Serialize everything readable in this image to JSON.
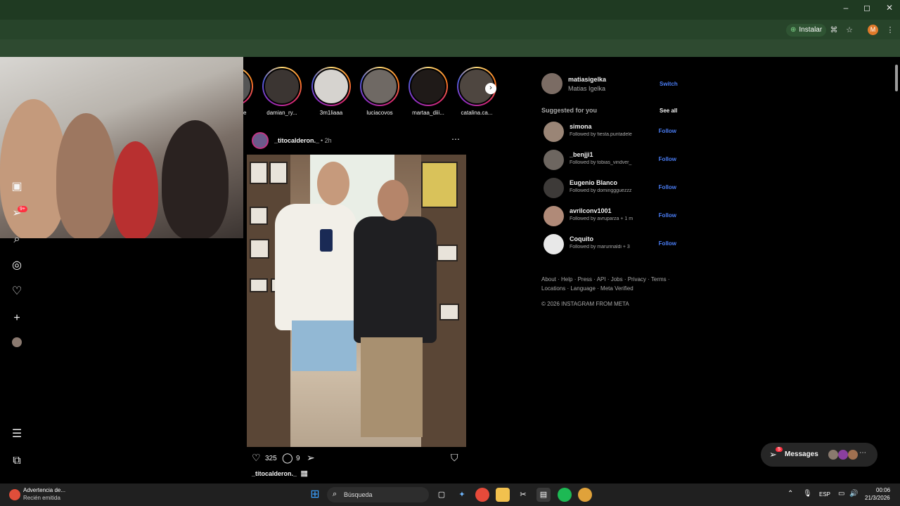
{
  "browser": {
    "install_label": "Instalar",
    "profile_initial": "M",
    "window_controls": [
      "–",
      "◻",
      "✕"
    ]
  },
  "sidebar": {
    "notifications_badge": "9+"
  },
  "stories": [
    {
      "label": "e"
    },
    {
      "label": "damian_ry..."
    },
    {
      "label": "3m1liaaa"
    },
    {
      "label": "luciacovos"
    },
    {
      "label": "martaa_diii..."
    },
    {
      "label": "catalina.ca..."
    }
  ],
  "post": {
    "username": "_titocalderon._",
    "time": "• 2h",
    "likes": "325",
    "comments": "9",
    "caption_user": "_titocalderon._",
    "caption_emoji": "🏽"
  },
  "account": {
    "username": "matiasigelka",
    "fullname": "Matias Igelka",
    "switch_label": "Switch"
  },
  "suggested": {
    "title": "Suggested for you",
    "see_all": "See all",
    "follow_label": "Follow",
    "users": [
      {
        "username": "simona",
        "sub": "Followed by fiesta.puntadele"
      },
      {
        "username": "_benjji1",
        "sub": "Followed by tobias_vindver_"
      },
      {
        "username": "Eugenio Blanco",
        "sub": "Followed by dominggguezzz"
      },
      {
        "username": "avrilconv1001",
        "sub": "Followed by avruparza + 1 m"
      },
      {
        "username": "Coquito",
        "sub": "Followed by marurinaldi + 3"
      }
    ]
  },
  "footer": {
    "links_line1": "About · Help · Press · API · Jobs · Privacy · Terms ·",
    "links_line2": "Locations · Language · Meta Verified",
    "copyright": "© 2026 INSTAGRAM FROM META"
  },
  "messages": {
    "label": "Messages",
    "badge": "5"
  },
  "taskbar": {
    "notif_title": "Advertencia de...",
    "notif_sub": "Recién emitida",
    "search_placeholder": "Búsqueda",
    "lang": "ESP",
    "time": "00:06",
    "date": "21/3/2026"
  },
  "colors": {
    "accent_blue": "#4a7df5",
    "badge_red": "#ff3040",
    "titlebar_green": "#1f3a22"
  }
}
